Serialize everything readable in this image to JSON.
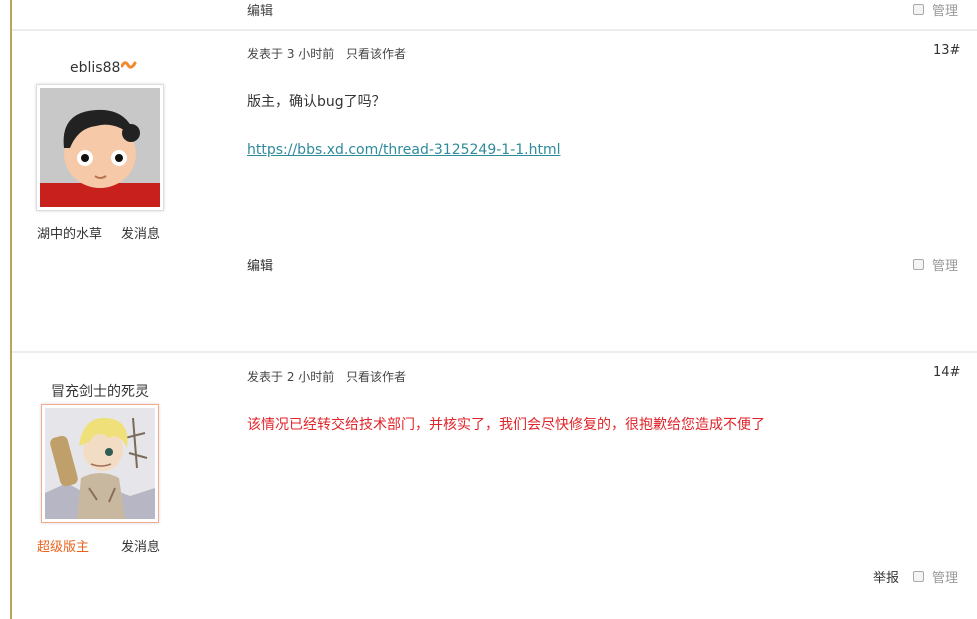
{
  "top_footer": {
    "edit_label": "编辑",
    "manage_label": "管理"
  },
  "posts": [
    {
      "username": "eblis88",
      "group_label": "湖中的水草",
      "message_label": "发消息",
      "posted_time": "发表于 3 小时前",
      "only_author": "只看该作者",
      "floor": "13#",
      "content_line1": "版主，确认bug了吗？",
      "content_link": "https://bbs.xd.com/thread-3125249-1-1.html",
      "edit_label": "编辑",
      "manage_label": "管理"
    },
    {
      "username": "冒充剑士的死灵",
      "group_label": "超级版主",
      "message_label": "发消息",
      "posted_time": "发表于 2 小时前",
      "only_author": "只看该作者",
      "floor": "14#",
      "content_line1": "该情况已经转交给技术部门，并核实了，我们会尽快修复的，很抱歉给您造成不便了",
      "report_label": "举报",
      "manage_label": "管理"
    }
  ],
  "colors": {
    "accent_bar": "#b9a458",
    "moderator": "#e8641e",
    "reply_text": "#e0242a",
    "link": "#2e8b9a"
  }
}
